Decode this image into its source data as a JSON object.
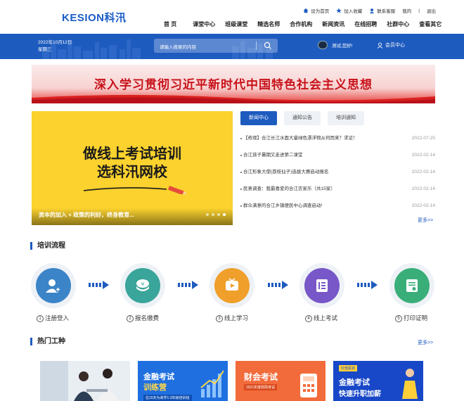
{
  "header": {
    "logo_en": "KESION",
    "logo_cn": "科汛",
    "top_links": [
      "设为首页",
      "加入收藏",
      "联系客服",
      "我的",
      "退出"
    ],
    "nav": [
      "首 页",
      "课堂中心",
      "班级课堂",
      "精选名师",
      "合作机构",
      "新闻资讯",
      "在线招聘",
      "社群中心",
      "查看其它"
    ]
  },
  "banner": {
    "date": "2022年10月12日",
    "weekday": "星期三",
    "search_placeholder": "请输入搜索的内容",
    "greeting": "测试,您好!",
    "member_center": "会员中心"
  },
  "slogan": "深入学习贯彻习近平新时代中国特色社会主义思想",
  "carousel": {
    "line1": "做线上考试培训",
    "line2": "选科汛网校",
    "caption": "资本的加入 + 政策的利好，终身教育...",
    "slides": 4,
    "active_slide": 4
  },
  "news": {
    "tabs": [
      "新闻中心",
      "通知公告",
      "培训通知"
    ],
    "active_tab": 0,
    "items": [
      {
        "title": "【奇观】合江长江水面大量绿色漂浮物从何而来？求证！",
        "date": "2022-07-25"
      },
      {
        "title": "合江孩子暑期又走进第二课堂",
        "date": "2022-02-14"
      },
      {
        "title": "合江形象大使(荔枝仙子)选拔大赛启动报名",
        "date": "2022-02-14"
      },
      {
        "title": "民意调查：我最喜爱的合江农家乐（共15家）",
        "date": "2022-02-14"
      },
      {
        "title": "群众满意的合江乡镇便民中心调查启动!",
        "date": "2022-02-14"
      }
    ],
    "more": "更多>>"
  },
  "process": {
    "title": "培训流程",
    "steps": [
      {
        "num": "1",
        "label": "注册登入",
        "color": "#3b84c7",
        "icon": "user-add-icon"
      },
      {
        "num": "2",
        "label": "报名缴费",
        "color": "#3aa59a",
        "icon": "payment-icon"
      },
      {
        "num": "3",
        "label": "线上学习",
        "color": "#ef9f2a",
        "icon": "video-icon"
      },
      {
        "num": "4",
        "label": "线上考试",
        "color": "#7857c8",
        "icon": "exam-icon"
      },
      {
        "num": "5",
        "label": "打印证明",
        "color": "#3aae79",
        "icon": "certificate-icon"
      }
    ]
  },
  "hot": {
    "title": "热门工种",
    "more": "更多>>",
    "cards": [
      {
        "title": "",
        "sub": "",
        "bg": "#dfe6ee"
      },
      {
        "title": "金融考试",
        "title2": "训练营",
        "sub": "在15天为来学1:3年级培训班",
        "bg": "#1f6fe0"
      },
      {
        "title": "财会考试",
        "sub": "2021年度财政考试",
        "bg": "#f26b3b"
      },
      {
        "title": "金融考试",
        "title2": "快速升职加薪",
        "sub": "价值投资",
        "bg": "#1848c8"
      }
    ]
  }
}
